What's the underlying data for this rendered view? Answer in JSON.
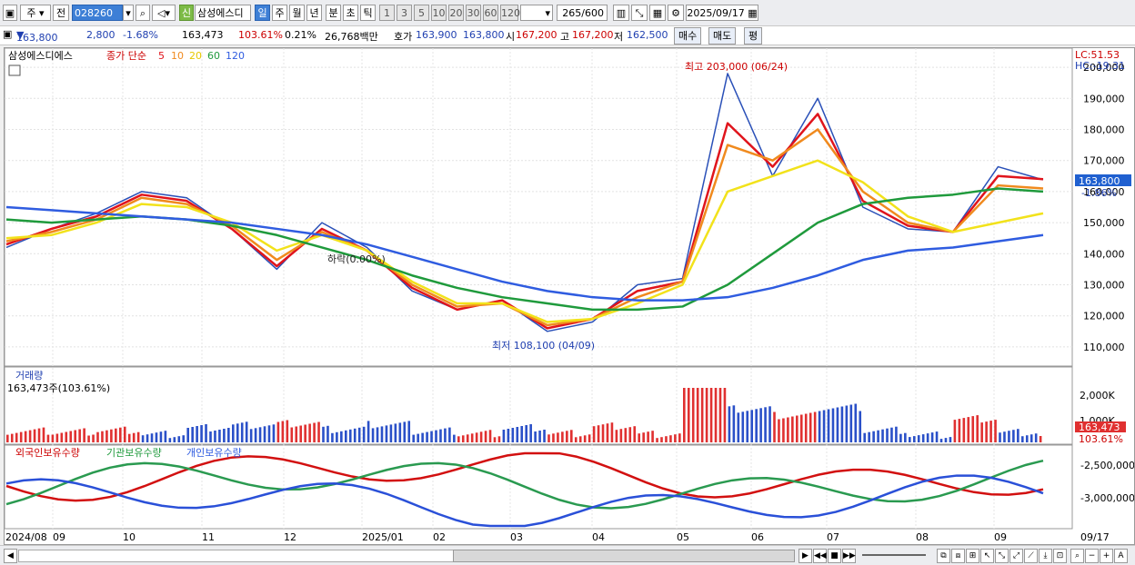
{
  "toolbar": {
    "market": "주",
    "prev": "전",
    "code": "028260",
    "shin": "신",
    "name": "삼성에스디",
    "periods": [
      "일",
      "주",
      "월",
      "년",
      "분",
      "초",
      "틱"
    ],
    "active_period": "일",
    "nums": [
      "1",
      "3",
      "5",
      "10",
      "20",
      "30",
      "60",
      "120"
    ],
    "count": "265",
    "count_total": "/600",
    "date": "2025/09/17"
  },
  "quote": {
    "price": "163,800",
    "change": "2,800",
    "change_pct": "-1.68%",
    "volume": "163,473",
    "vol_ratio": "103.61%",
    "turnover_pct": "0.21%",
    "amount": "26,768백만",
    "hoga_label": "호가",
    "ask": "163,900",
    "bid": "163,800",
    "open_label": "시",
    "open": "167,200",
    "high_label": "고",
    "high": "167,200",
    "low_label": "저",
    "low": "162,500",
    "buy": "매수",
    "sell": "매도",
    "avg": "평"
  },
  "price_panel": {
    "stock_name": "삼성에스디에스",
    "ma_title": "종가 단순",
    "ma_periods": [
      "5",
      "10",
      "20",
      "60",
      "120"
    ],
    "ma_colors": [
      "#e0141c",
      "#f08a1e",
      "#f2e21b",
      "#1f9a3c",
      "#2f5ce0"
    ],
    "lc": "LC:51.53",
    "hc": "HC:-19.31",
    "max_label": "최고 203,000 (06/24)",
    "min_label": "최저 108,100 (04/09)",
    "note_label": "하락(0.00%)",
    "y_ticks": [
      "200,000",
      "190,000",
      "180,000",
      "170,000",
      "160,000",
      "150,000",
      "140,000",
      "130,000",
      "120,000",
      "110,000"
    ],
    "last_price": "163,800",
    "last_pct": "-1.86%"
  },
  "volume_panel": {
    "title": "거래량",
    "value": "163,473주(103.61%)",
    "y_ticks": [
      "2,000K",
      "1,000K"
    ],
    "last": "163,473",
    "last_pct": "103.61%"
  },
  "holding_panel": {
    "titles": [
      "외국인보유수량",
      "기관보유수량",
      "개인보유수량"
    ],
    "y_ticks": [
      "-2,500,000",
      "-3,000,000"
    ]
  },
  "x_labels": [
    "2024/08",
    "09",
    "10",
    "11",
    "12",
    "2025/01",
    "02",
    "03",
    "04",
    "05",
    "06",
    "07",
    "08",
    "09",
    "09/17"
  ],
  "chart_data": {
    "type": "line",
    "series": [
      {
        "name": "삼성에스디에스",
        "values": [
          142000,
          148000,
          153000,
          160000,
          158000,
          148000,
          135000,
          150000,
          142000,
          128000,
          122000,
          125000,
          115000,
          118000,
          130000,
          132000,
          198000,
          165000,
          190000,
          155000,
          148000,
          147000,
          168000,
          163800
        ]
      },
      {
        "name": "5",
        "values": [
          143000,
          148000,
          152000,
          159000,
          157000,
          148000,
          136000,
          148000,
          141000,
          129000,
          122000,
          125000,
          116000,
          119000,
          128000,
          131000,
          182000,
          168000,
          185000,
          157000,
          149000,
          147000,
          165000,
          164000
        ]
      },
      {
        "name": "10",
        "values": [
          144000,
          147000,
          151000,
          158000,
          156000,
          149000,
          138000,
          147000,
          141000,
          130000,
          123000,
          124000,
          117000,
          119000,
          126000,
          131000,
          175000,
          170000,
          180000,
          160000,
          150000,
          147000,
          162000,
          161000
        ]
      },
      {
        "name": "20",
        "values": [
          145000,
          146000,
          150000,
          156000,
          155000,
          150000,
          141000,
          146000,
          141000,
          131000,
          124000,
          124000,
          118000,
          119000,
          124000,
          130000,
          160000,
          165000,
          170000,
          163000,
          152000,
          147000,
          150000,
          153000
        ]
      },
      {
        "name": "60",
        "values": [
          151000,
          150000,
          151000,
          152000,
          151000,
          149000,
          146000,
          142000,
          138000,
          133000,
          129000,
          126000,
          124000,
          122000,
          122000,
          123000,
          130000,
          140000,
          150000,
          156000,
          158000,
          159000,
          161000,
          160000
        ]
      },
      {
        "name": "120",
        "values": [
          155000,
          154000,
          153000,
          152000,
          151000,
          150000,
          148000,
          146000,
          143000,
          139000,
          135000,
          131000,
          128000,
          126000,
          125000,
          125000,
          126000,
          129000,
          133000,
          138000,
          141000,
          142000,
          144000,
          146000
        ]
      }
    ],
    "ylim": [
      105000,
      205000
    ]
  }
}
